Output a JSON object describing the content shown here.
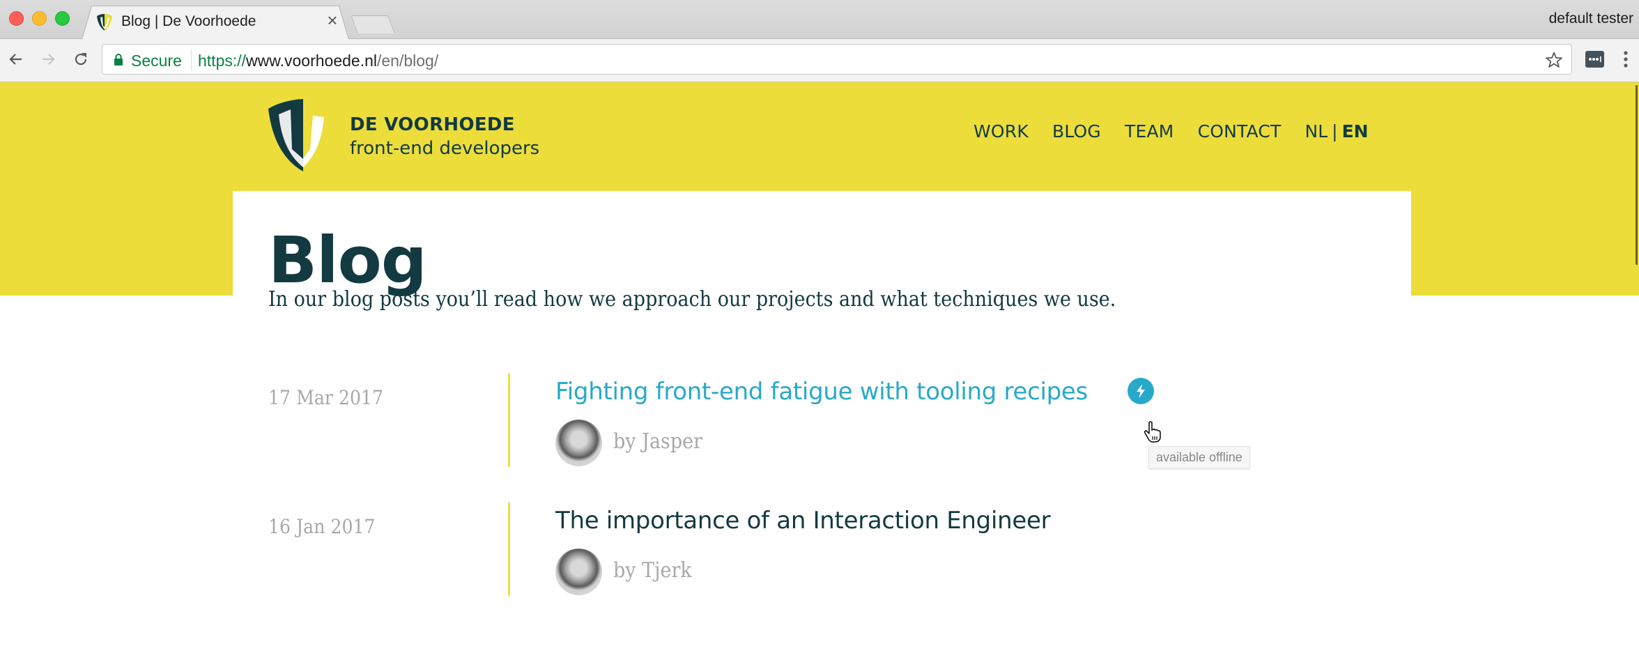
{
  "browser": {
    "tab": {
      "title": "Blog | De Voorhoede",
      "close_glyph": "×",
      "favicon": "voorhoede-shield-icon"
    },
    "profile_name": "default tester",
    "address_bar": {
      "security_label": "Secure",
      "url_scheme": "https://",
      "url_host": "www.voorhoede.nl",
      "url_path": "/en/blog/"
    },
    "icons": {
      "back": "arrow-left-icon",
      "forward": "arrow-right-icon",
      "reload": "reload-icon",
      "lock": "lock-icon",
      "bookmark": "star-icon",
      "extension": "password-manager-icon",
      "menu": "kebab-menu-icon"
    }
  },
  "site": {
    "brand": {
      "name": "DE VOORHOEDE",
      "tagline": "front-end developers"
    },
    "nav": {
      "items": [
        {
          "label": "WORK"
        },
        {
          "label": "BLOG"
        },
        {
          "label": "TEAM"
        },
        {
          "label": "CONTACT"
        }
      ],
      "languages": {
        "nl": "NL",
        "separator": "|",
        "en": "EN",
        "active": "EN"
      }
    },
    "colors": {
      "brand_yellow": "#ecdd3b",
      "brand_dark": "#133a41",
      "link_blue": "#28a9c9",
      "muted_gray": "#a8a8a8"
    }
  },
  "page": {
    "title": "Blog",
    "intro": "In our blog posts you’ll read how we approach our projects and what techniques we use.",
    "posts": [
      {
        "date": "17 Mar 2017",
        "title": "Fighting front-end fatigue with tooling recipes",
        "author": "by Jasper",
        "available_offline": true,
        "offline_icon": "lightning-bolt-icon"
      },
      {
        "date": "16 Jan 2017",
        "title": "The importance of an Interaction Engineer",
        "author": "by Tjerk",
        "available_offline": false
      }
    ],
    "tooltip": "available offline"
  }
}
